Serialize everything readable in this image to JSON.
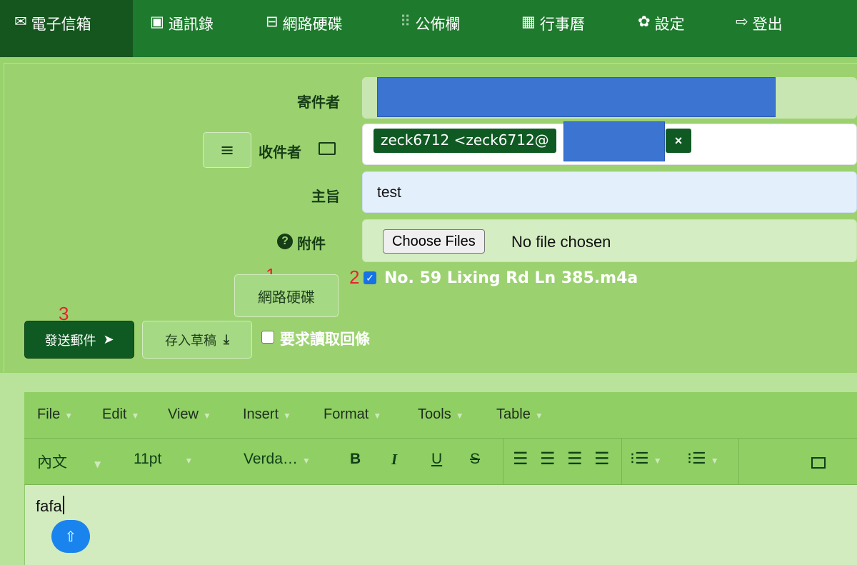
{
  "nav": {
    "items": [
      {
        "icon": "✉",
        "label": "電子信箱"
      },
      {
        "icon": "▣",
        "label": "通訊錄"
      },
      {
        "icon": "⊟",
        "label": "網路硬碟"
      },
      {
        "icon": "⠿",
        "label": "公佈欄"
      },
      {
        "icon": "▦",
        "label": "行事曆"
      },
      {
        "icon": "✿",
        "label": "設定"
      },
      {
        "icon": "⇨",
        "label": "登出"
      }
    ]
  },
  "form": {
    "sender_label": "寄件者",
    "recipient_label": "收件者",
    "recipient_tag": "zeck6712 <zeck6712@",
    "recipient_remove": "×",
    "subject_label": "主旨",
    "subject_value": "test",
    "attachment_label": "附件",
    "choose_files": "Choose Files",
    "no_file": "No file chosen",
    "netdisk_button": "網路硬碟",
    "attached_file": "No. 59 Lixing Rd Ln 385.m4a",
    "send_button": "發送郵件",
    "draft_button": "存入草稿",
    "read_receipt": "要求讀取回條"
  },
  "markers": [
    "1",
    "2",
    "3"
  ],
  "editor": {
    "menu": [
      "File",
      "Edit",
      "View",
      "Insert",
      "Format",
      "Tools",
      "Table"
    ],
    "block_format": "內文",
    "font_size": "11pt",
    "font_family": "Verda…",
    "bold": "B",
    "italic": "I",
    "underline": "U",
    "strike": "S",
    "content": "fafa"
  },
  "colors": {
    "nav_bg": "#1e7a2d",
    "panel_bg": "#9bd26f",
    "accent_dark": "#0f5a22",
    "redaction": "#3b74d1",
    "marker": "#e3262a"
  }
}
